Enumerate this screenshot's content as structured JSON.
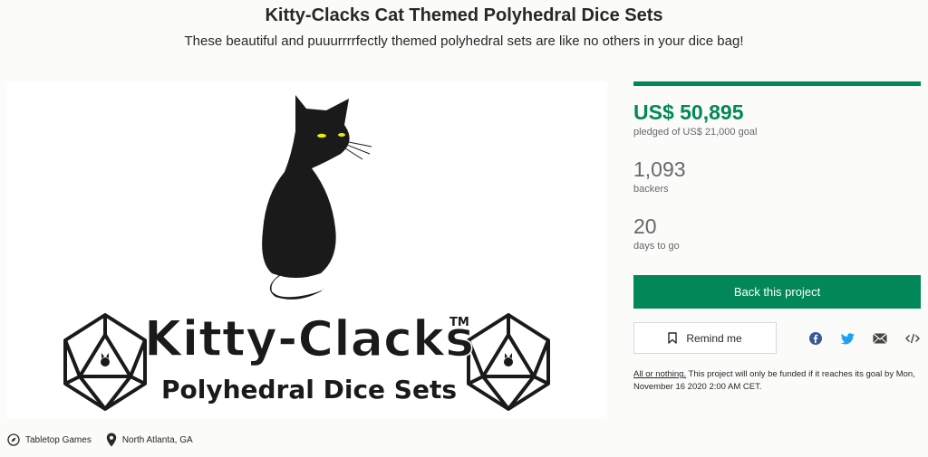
{
  "project": {
    "title": "Kitty-Clacks Cat Themed Polyhedral Dice Sets",
    "blurb": "These beautiful and puuurrrrfectly themed polyhedral sets are like no others in your dice bag!"
  },
  "hero_image": {
    "logo_line1": "Kitty-Clacks",
    "trademark": "TM",
    "logo_line2": "Polyhedral Dice Sets"
  },
  "meta": {
    "category": "Tabletop Games",
    "location": "North Atlanta, GA"
  },
  "funding": {
    "progress_fraction": 1.0,
    "pledged": "US$ 50,895",
    "pledged_label": "pledged of US$ 21,000 goal",
    "backers": "1,093",
    "backers_label": "backers",
    "days": "20",
    "days_label": "days to go"
  },
  "actions": {
    "back_label": "Back this project",
    "remind_label": "Remind me"
  },
  "share_icons": [
    "facebook-icon",
    "twitter-icon",
    "email-icon",
    "embed-icon"
  ],
  "fine_print": {
    "link_text": "All or nothing.",
    "text": " This project will only be funded if it reaches its goal by Mon, November 16 2020 2:00 AM CET."
  },
  "colors": {
    "accent": "#028858",
    "facebook": "#3b5998",
    "twitter": "#1da1f2",
    "text_muted": "#656969"
  }
}
